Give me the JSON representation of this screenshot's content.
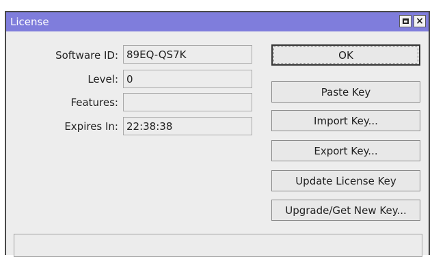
{
  "window": {
    "title": "License",
    "maximize_label": "",
    "close_label": "×"
  },
  "fields": [
    {
      "label": "Software ID:",
      "value": "89EQ-QS7K"
    },
    {
      "label": "Level:",
      "value": "0"
    },
    {
      "label": "Features:",
      "value": ""
    },
    {
      "label": "Expires In:",
      "value": "22:38:38"
    }
  ],
  "buttons": {
    "ok": "OK",
    "paste_key": "Paste Key",
    "import_key": "Import Key...",
    "export_key": "Export Key...",
    "update_license_key": "Update License Key",
    "upgrade_get_new_key": "Upgrade/Get New Key..."
  },
  "status": {
    "text": ""
  },
  "colors": {
    "titlebar": "#7f7ddc",
    "window_bg": "#ededed"
  }
}
